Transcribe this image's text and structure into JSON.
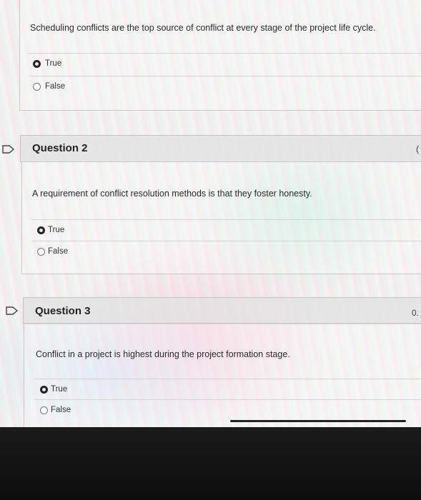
{
  "question1": {
    "text": "Scheduling conflicts are the top source of conflict at every stage of the project life cycle.",
    "options": [
      {
        "label": "True",
        "selected": true
      },
      {
        "label": "False",
        "selected": false
      }
    ]
  },
  "question2": {
    "title": "Question 2",
    "points": "(",
    "text": "A requirement of conflict resolution methods is that they foster honesty.",
    "options": [
      {
        "label": "True",
        "selected": true
      },
      {
        "label": "False",
        "selected": false
      }
    ]
  },
  "question3": {
    "title": "Question 3",
    "points": "0.",
    "text": "Conflict in a project is highest during the project formation stage.",
    "options": [
      {
        "label": "True",
        "selected": true
      },
      {
        "label": "False",
        "selected": false
      }
    ]
  },
  "icons": {
    "question_flag": "flag-icon",
    "radio": "radio-icon"
  },
  "colors": {
    "selected_radio": "#222222",
    "unselected_radio": "#777777",
    "header_bg": "#e2e2e2"
  }
}
